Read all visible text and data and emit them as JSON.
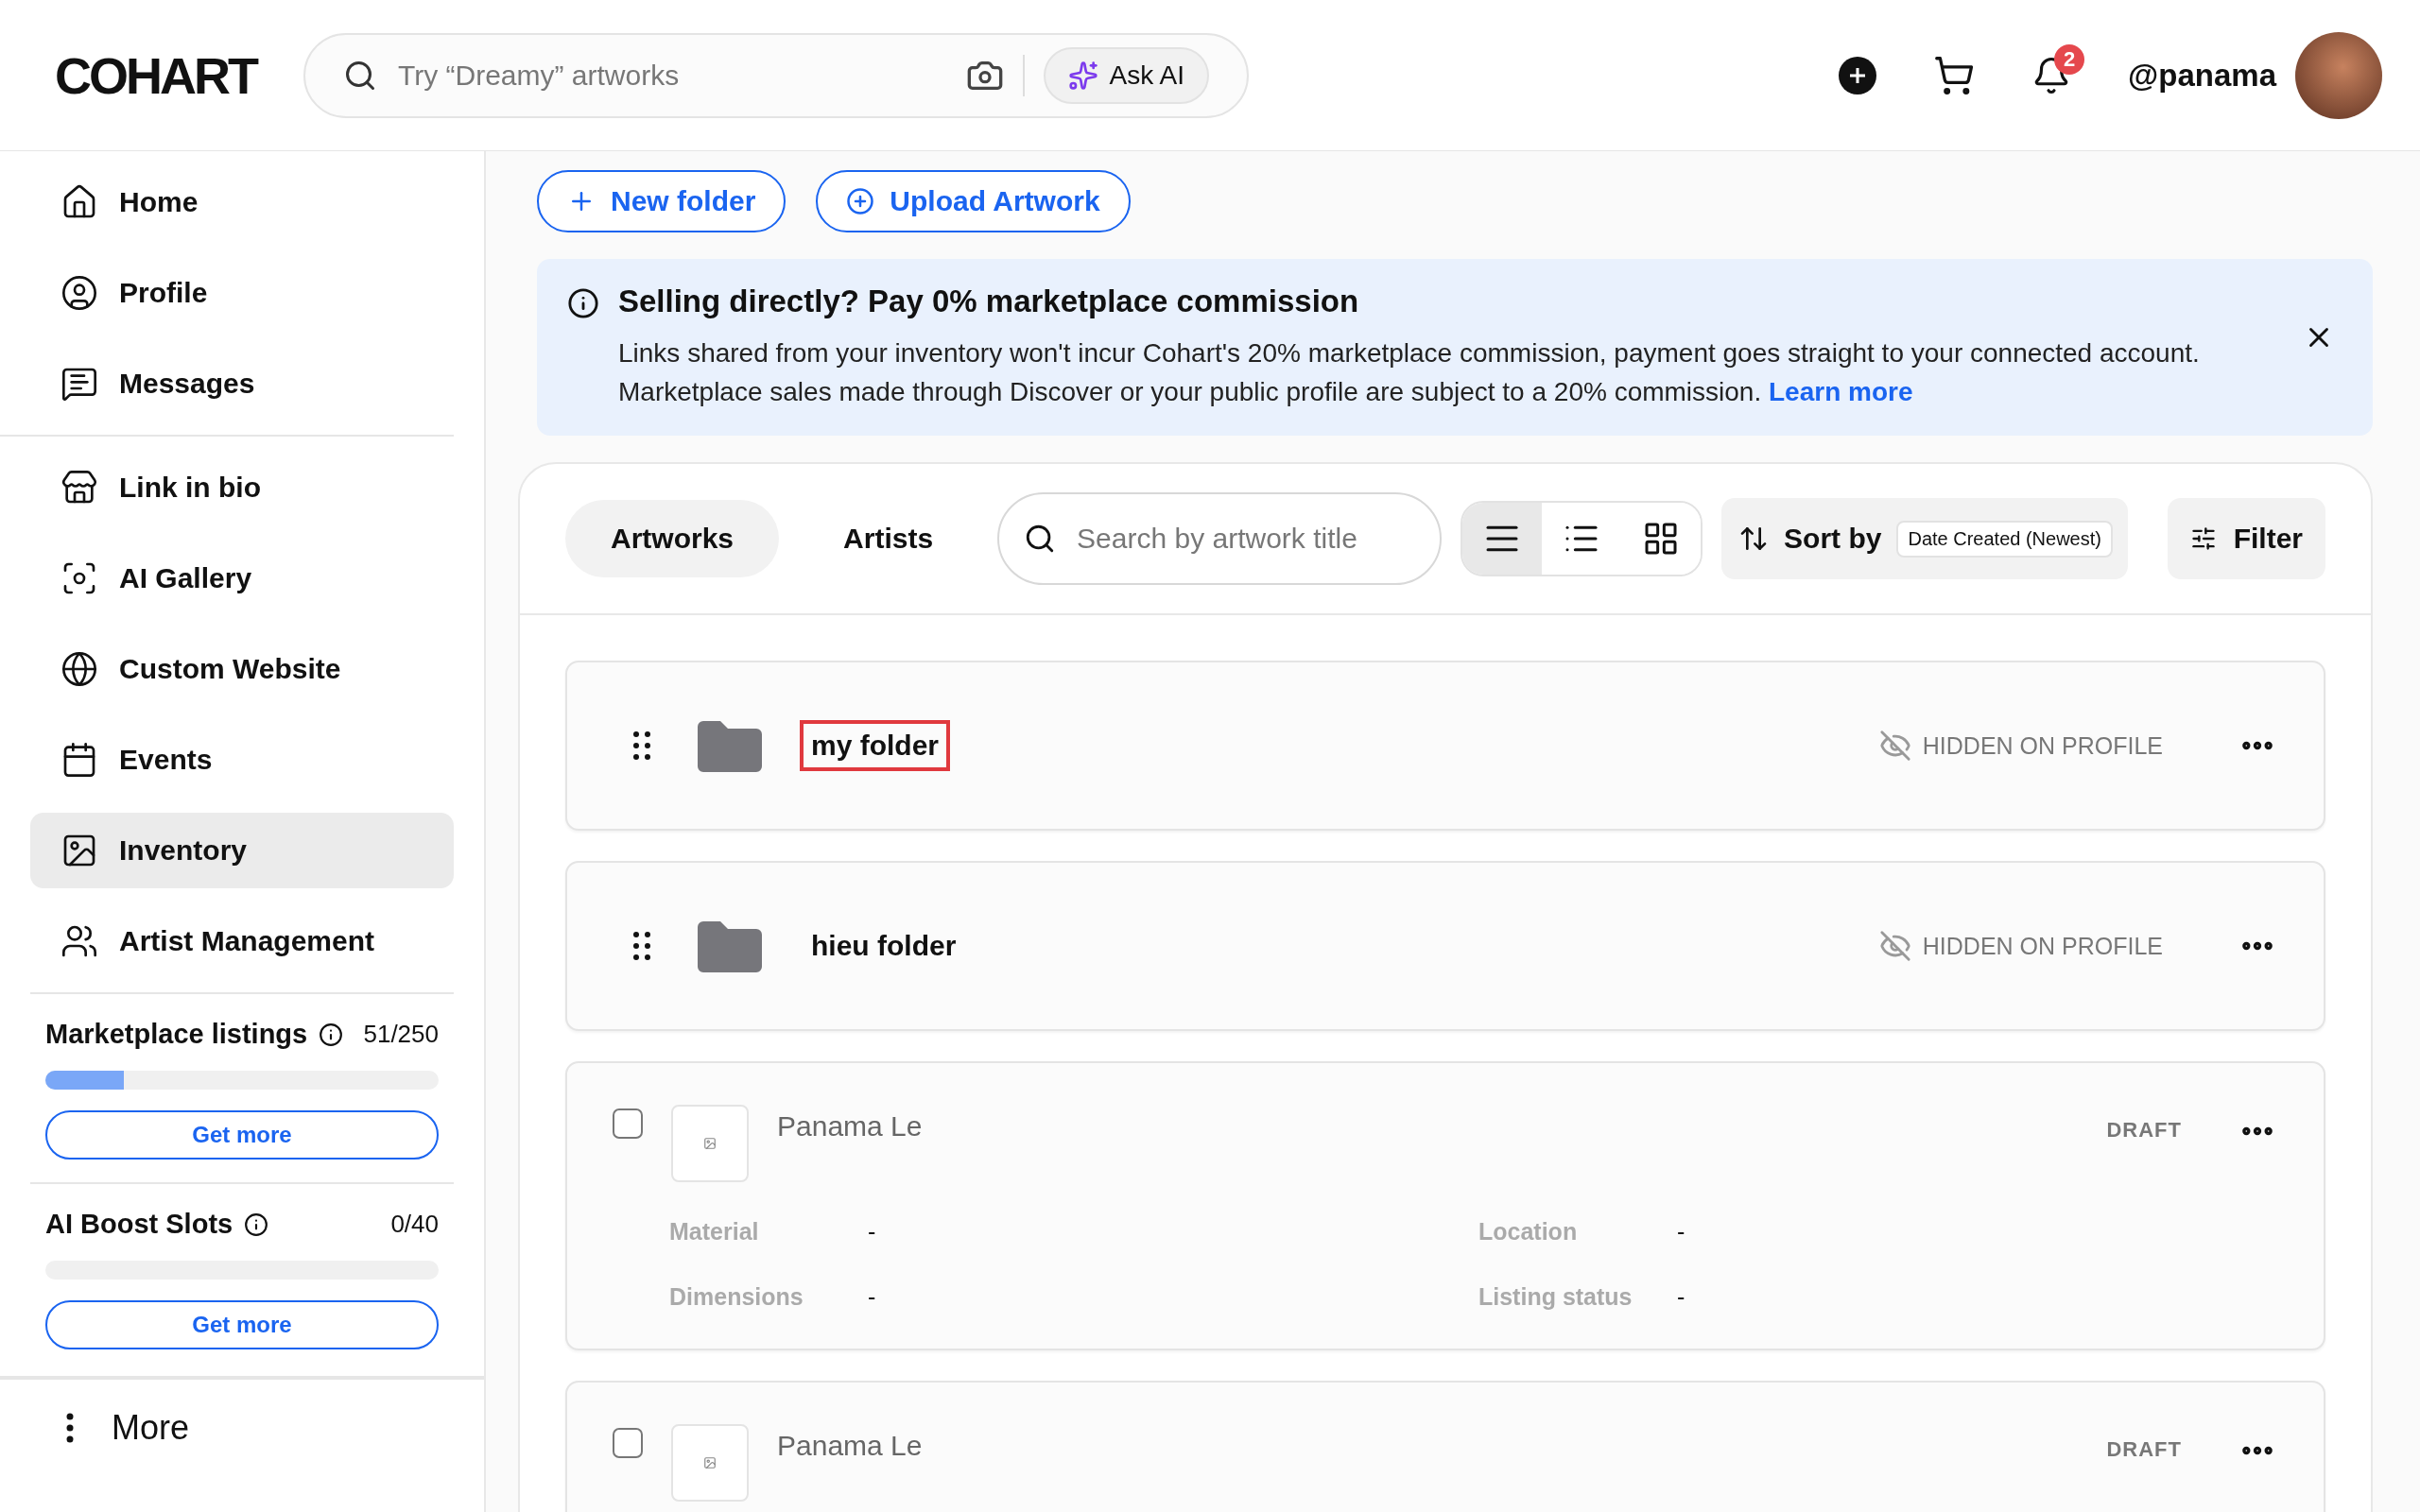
{
  "header": {
    "logo": "COHART",
    "search": {
      "placeholder": "Try “Dreamy” artworks"
    },
    "ask_ai": "Ask AI",
    "notification_count": "2",
    "username": "@panama"
  },
  "sidebar": {
    "groups": [
      [
        {
          "label": "Home",
          "selected": false
        },
        {
          "label": "Profile",
          "selected": false
        },
        {
          "label": "Messages",
          "selected": false
        }
      ],
      [
        {
          "label": "Link in bio",
          "selected": false
        },
        {
          "label": "AI Gallery",
          "selected": false
        },
        {
          "label": "Custom Website",
          "selected": false
        },
        {
          "label": "Events",
          "selected": false
        },
        {
          "label": "Inventory",
          "selected": true
        },
        {
          "label": "Artist Management",
          "selected": false
        }
      ]
    ],
    "quotas": [
      {
        "label": "Marketplace listings",
        "count": "51/250",
        "level": 0.2,
        "button": "Get more"
      },
      {
        "label": "AI Boost Slots",
        "count": "0/40",
        "level": 0,
        "button": "Get more"
      }
    ],
    "more": "More"
  },
  "actions": [
    "New folder",
    "Upload Artwork"
  ],
  "banner": {
    "title": "Selling directly? Pay 0% marketplace commission",
    "body": "Links shared from your inventory won't incur Cohart's 20% marketplace commission, payment goes straight to your connected account. Marketplace sales made through Discover or your public profile are subject to a 20% commission.",
    "link": "Learn more"
  },
  "toolbar": {
    "tabs": [
      {
        "label": "Artworks",
        "selected": true
      },
      {
        "label": "Artists",
        "selected": false
      }
    ],
    "search": {
      "placeholder": "Search by artwork title"
    },
    "view_modes": [
      {
        "selected": true
      },
      {
        "selected": false
      },
      {
        "selected": false
      }
    ],
    "sort": {
      "label": "Sort by",
      "value": "Date Created (Newest)"
    },
    "filter": "Filter"
  },
  "folders": [
    {
      "name": "my folder",
      "highlighted": true,
      "visibility": "HIDDEN ON PROFILE"
    },
    {
      "name": "hieu folder",
      "highlighted": false,
      "visibility": "HIDDEN ON PROFILE"
    }
  ],
  "artworks": [
    {
      "artist": "Panama Le",
      "status": "DRAFT",
      "checked": false,
      "fields": [
        {
          "label": "Material",
          "value": "-"
        },
        {
          "label": "Location",
          "value": "-"
        },
        {
          "label": "Dimensions",
          "value": "-"
        },
        {
          "label": "Listing status",
          "value": "-"
        }
      ]
    },
    {
      "artist": "Panama Le",
      "status": "DRAFT",
      "checked": false
    }
  ]
}
